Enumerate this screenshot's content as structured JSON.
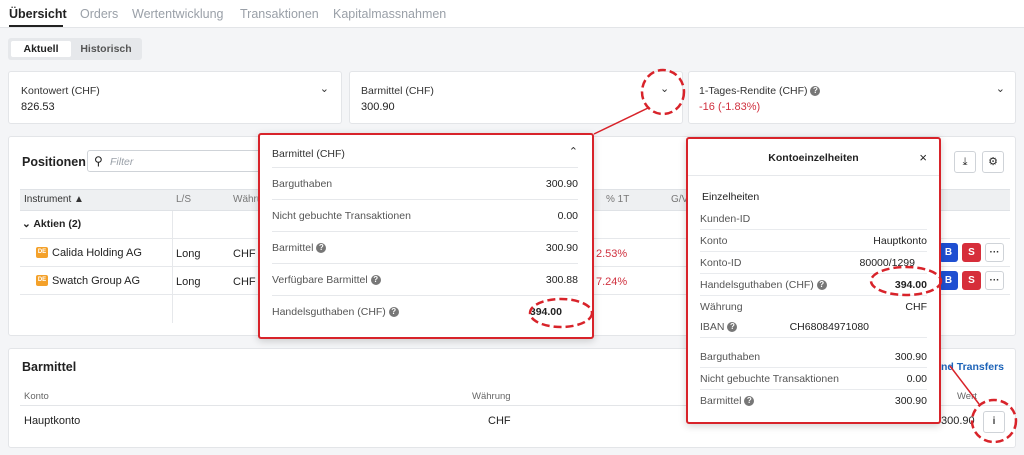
{
  "nav": {
    "tabs": [
      "Übersicht",
      "Orders",
      "Wertentwicklung",
      "Transaktionen",
      "Kapitalmassnahmen"
    ]
  },
  "segment": {
    "current": "Aktuell",
    "history": "Historisch"
  },
  "summary": {
    "kontowert_label": "Kontowert (CHF)",
    "kontowert_value": "826.53",
    "barmittel_label": "Barmittel (CHF)",
    "barmittel_value": "300.90",
    "rendite_label": "1-Tages-Rendite (CHF)",
    "rendite_value": "-16 (-1.83%)"
  },
  "positions": {
    "title": "Positionen",
    "filter_placeholder": "Filter",
    "headers": {
      "instrument": "Instrument ▲",
      "ls": "L/S",
      "currency": "Währu",
      "pct1t": "% 1T",
      "gv": "G/V"
    },
    "group_label": "Aktien (2)",
    "rows": [
      {
        "name": "Calida Holding AG",
        "ls": "Long",
        "currency": "CHF",
        "pct": "2.53%"
      },
      {
        "name": "Swatch Group AG",
        "ls": "Long",
        "currency": "CHF",
        "pct": "7.24%"
      }
    ],
    "buy": "B",
    "sell": "S",
    "more": "···",
    "coin": "DE"
  },
  "cash": {
    "title": "Barmittel",
    "fund_transfers": "nd Transfers",
    "headers": {
      "konto": "Konto",
      "waehrung": "Währung",
      "wert": "Wert"
    },
    "row": {
      "konto": "Hauptkonto",
      "waehrung": "CHF",
      "wert": "300.90"
    },
    "info": "i"
  },
  "cash_popup": {
    "title": "Barmittel (CHF)",
    "rows": [
      {
        "label": "Barguthaben",
        "value": "300.90"
      },
      {
        "label": "Nicht gebuchte Transaktionen",
        "value": "0.00"
      },
      {
        "label": "Barmittel",
        "value": "300.90"
      },
      {
        "label": "Verfügbare Barmittel",
        "value": "300.88"
      },
      {
        "label": "Handelsguthaben (CHF)",
        "value": "394.00"
      }
    ]
  },
  "details": {
    "title": "Kontoeinzelheiten",
    "section": "Einzelheiten",
    "kunden_id": "Kunden-ID",
    "konto_label": "Konto",
    "konto_value": "Hauptkonto",
    "konto_id_label": "Konto-ID",
    "konto_id_value": "80000/1299",
    "handel_label": "Handelsguthaben (CHF)",
    "handel_value": "394.00",
    "waehrung_label": "Währung",
    "waehrung_value": "CHF",
    "iban_label": "IBAN",
    "iban_value": "CH68084971080",
    "bar_label": "Barguthaben",
    "bar_value": "300.90",
    "ngt_label": "Nicht gebuchte Transaktionen",
    "ngt_value": "0.00",
    "barmittel_label": "Barmittel",
    "barmittel_value": "300.90"
  },
  "colors": {
    "highlight": "#d8232a",
    "buy": "#1f4fd1",
    "sell": "#d62e3a",
    "link": "#1d63b8"
  }
}
